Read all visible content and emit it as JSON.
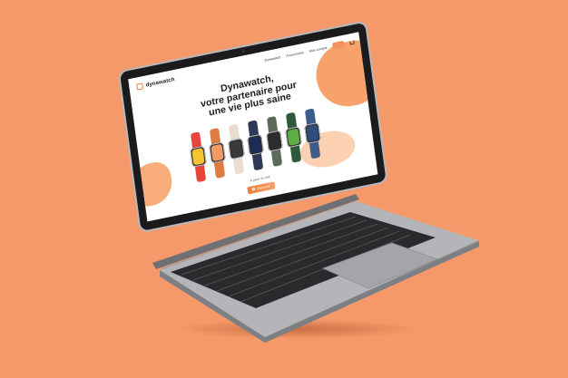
{
  "colors": {
    "background": "#f5996a",
    "accent": "#f07e3a",
    "laptop_body": "#a7a8ab",
    "bezel": "#1b1b1d"
  },
  "site": {
    "logo_text": "dynawatch",
    "logo_icon": "watch-logo-icon",
    "nav_links": [
      "Dynawatch",
      "Accessoires",
      "Mon compte"
    ],
    "nav_button": "",
    "cart_icon": "cart-icon",
    "hero_title_lines": [
      "Dynawatch,",
      "votre partenaire pour",
      "une vie plus saine"
    ],
    "cta_subtext": "À partir de 99€",
    "cta_button": "Découvrir",
    "watches": [
      {
        "strap": "#e8453c",
        "face": "#f6c431"
      },
      {
        "strap": "#e07a43",
        "face": "#f39b67"
      },
      {
        "strap": "#e9ddd0",
        "face": "#3a3a3a"
      },
      {
        "strap": "#2f3856",
        "face": "#1e2c55"
      },
      {
        "strap": "#5d6a5a",
        "face": "#2c2c2c"
      },
      {
        "strap": "#2e5a3c",
        "face": "#5fae44"
      },
      {
        "strap": "#3d5c8a",
        "face": "#2f4d7a"
      }
    ]
  }
}
